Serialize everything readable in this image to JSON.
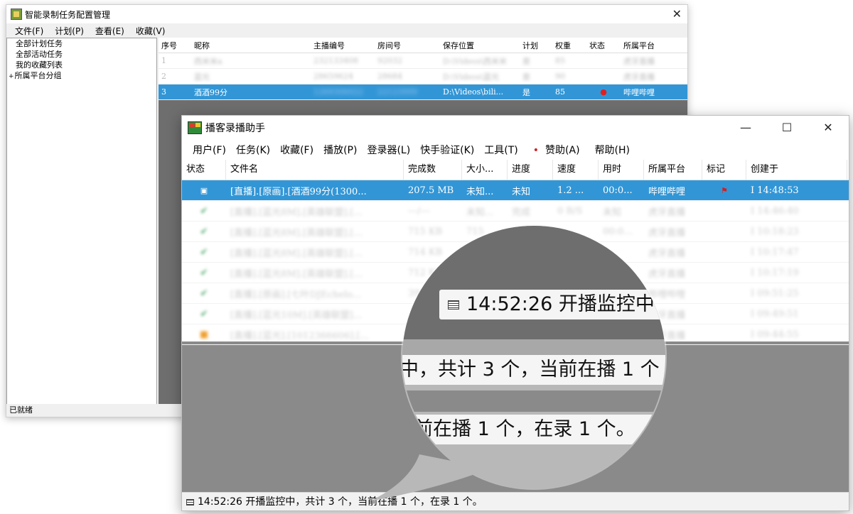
{
  "back_window": {
    "title": "智能录制任务配置管理",
    "menu": [
      "文件(F)",
      "计划(P)",
      "查看(E)",
      "收藏(V)"
    ],
    "tree": [
      "全部计划任务",
      "全部活动任务",
      "我的收藏列表",
      "所属平台分组"
    ],
    "columns": [
      "序号",
      "昵称",
      "主播编号",
      "房间号",
      "保存位置",
      "计划",
      "权重",
      "状态",
      "所属平台"
    ],
    "rows": [
      {
        "no": "1",
        "nick": "西米米a",
        "id": "232133408",
        "room": "92032",
        "path": "D:\\Videos\\西米米",
        "plan": "是",
        "weight": "85",
        "state": "",
        "platform": "虎牙直播"
      },
      {
        "no": "2",
        "nick": "蓝光",
        "id": "28659624",
        "room": "28684",
        "path": "D:\\Videos\\蓝光",
        "plan": "是",
        "weight": "90",
        "state": "",
        "platform": "虎牙直播"
      },
      {
        "no": "3",
        "nick": "酒酒99分",
        "id": "1269306022",
        "room": "22123999",
        "path": "D:\\Videos\\bili...",
        "plan": "是",
        "weight": "85",
        "state": "●",
        "platform": "哔哩哔哩"
      }
    ],
    "status": "已就绪"
  },
  "front_window": {
    "title": "播客录播助手",
    "menu": [
      "用户(F)",
      "任务(K)",
      "收藏(F)",
      "播放(P)",
      "登录器(L)",
      "快手验证(K)",
      "工具(T)",
      "赞助(A)",
      "帮助(H)"
    ],
    "columns": [
      "状态",
      "文件名",
      "完成数",
      "大小...",
      "进度",
      "速度",
      "用时",
      "所属平台",
      "标记",
      "创建于"
    ],
    "rows": [
      {
        "icon": "rec",
        "name": "[直播].[原画].[酒酒99分(1300...",
        "done": "207.5 MB",
        "size": "未知...",
        "progress": "未知",
        "speed": "1.2 ...",
        "time": "00:0...",
        "platform": "哔哩哔哩",
        "mark": "flag",
        "created": "I 14:48:53"
      },
      {
        "icon": "ok",
        "name": "[直播].[蓝光8M].[英雄联盟].[...",
        "done": "---/---",
        "size": "未知...",
        "progress": "完成",
        "speed": "0 B/S",
        "time": "未知",
        "platform": "虎牙直播",
        "mark": "",
        "created": "I 14:46:40"
      },
      {
        "icon": "ok",
        "name": "[直播].[蓝光8M].[英雄联盟].[...",
        "done": "715 KB",
        "size": "715",
        "progress": "",
        "speed": "",
        "time": "00:0...",
        "platform": "虎牙直播",
        "mark": "",
        "created": "I 10:18:23"
      },
      {
        "icon": "ok",
        "name": "[直播].[蓝光8M].[英雄联盟].[...",
        "done": "714 KB",
        "size": "",
        "progress": "",
        "speed": "",
        "time": "",
        "platform": "虎牙直播",
        "mark": "",
        "created": "I 10:17:47"
      },
      {
        "icon": "ok",
        "name": "[直播].[蓝光8M].[英雄联盟].[...",
        "done": "712 KB",
        "size": "",
        "progress": "",
        "speed": "",
        "time": "",
        "platform": "虎牙直播",
        "mark": "",
        "created": "I 10:17:19"
      },
      {
        "icon": "ok",
        "name": "[直播].[原画].[七叶DJEchelo...",
        "done": "396",
        "size": "",
        "progress": "",
        "speed": "",
        "time": "",
        "platform": "哔哩哔哩",
        "mark": "",
        "created": "I 09:51:25"
      },
      {
        "icon": "ok",
        "name": "[直播].[蓝光10M].[英雄联盟]...",
        "done": "",
        "size": "",
        "progress": "",
        "speed": "",
        "time": "",
        "platform": "虎牙直播",
        "mark": "",
        "created": "I 09:49:51"
      },
      {
        "icon": "warn",
        "name": "[直播].[蓝光].[1012366606].[...",
        "done": "",
        "size": "",
        "progress": "",
        "speed": "",
        "time": "",
        "platform": "虎牙直播",
        "mark": "",
        "created": "I 09:44:55"
      }
    ],
    "status": "14:52:26 开播监控中，共计 3 个，当前在播 1 个，在录 1 个。"
  },
  "magnifier": {
    "line1": "14:52:26 开播监控中",
    "line2": "中，共计 3 个，当前在播 1 个",
    "line3": "前在播 1 个，在录 1 个。"
  }
}
